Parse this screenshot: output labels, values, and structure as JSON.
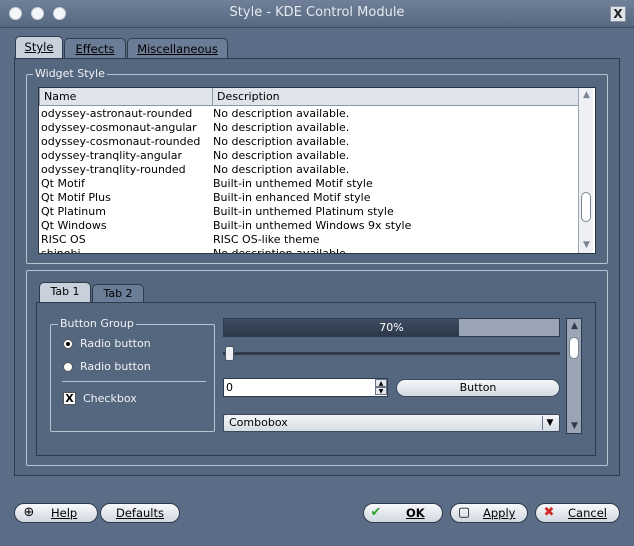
{
  "window": {
    "title": "Style - KDE Control Module",
    "close_label": "X"
  },
  "tabs": [
    {
      "label": "Style",
      "active": true
    },
    {
      "label": "Effects",
      "active": false
    },
    {
      "label": "Miscellaneous",
      "active": false
    }
  ],
  "widget_style": {
    "legend": "Widget Style",
    "columns": [
      "Name",
      "Description"
    ],
    "rows": [
      {
        "name": "odyssey-astronaut-rounded",
        "description": "No description available."
      },
      {
        "name": "odyssey-cosmonaut-angular",
        "description": "No description available."
      },
      {
        "name": "odyssey-cosmonaut-rounded",
        "description": "No description available."
      },
      {
        "name": "odyssey-tranqlity-angular",
        "description": "No description available."
      },
      {
        "name": "odyssey-tranqlity-rounded",
        "description": "No description available."
      },
      {
        "name": "Qt Motif",
        "description": "Built-in unthemed Motif style"
      },
      {
        "name": "Qt Motif Plus",
        "description": "Built-in enhanced Motif style"
      },
      {
        "name": "Qt Platinum",
        "description": "Built-in unthemed Platinum style"
      },
      {
        "name": "Qt Windows",
        "description": "Built-in unthemed Windows 9x style"
      },
      {
        "name": "RISC OS",
        "description": "RISC OS-like theme"
      },
      {
        "name": "shinobi",
        "description": "No description available."
      }
    ],
    "scroll_position": 0.84
  },
  "preview": {
    "tabs": [
      {
        "label": "Tab 1",
        "active": true
      },
      {
        "label": "Tab 2",
        "active": false
      }
    ],
    "button_group": {
      "legend": "Button Group",
      "radio1": "Radio button",
      "radio2": "Radio button",
      "checkbox": "Checkbox",
      "checkbox_mark": "X"
    },
    "progress": {
      "value": 0.7,
      "label": "70%"
    },
    "slider_value": 0,
    "spin_value": "0",
    "button_label": "Button",
    "combobox_label": "Combobox"
  },
  "footer": {
    "help": "Help",
    "defaults": "Defaults",
    "ok": "OK",
    "apply": "Apply",
    "cancel": "Cancel"
  },
  "colors": {
    "background": "#5a6c86",
    "ok_check": "#2aa52a",
    "cancel_x": "#d42a2a"
  }
}
